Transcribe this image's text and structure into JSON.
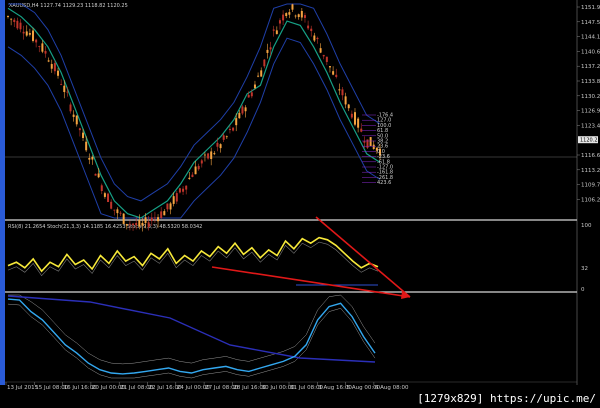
{
  "chart_data": {
    "type": "line",
    "header": {
      "symbol": "XAUUSD,H4",
      "ohlc": "1127.74 1129.23 1118.82 1120.25"
    },
    "price_axis": {
      "ticks": [
        "1151.94",
        "1147.54",
        "1144.14",
        "1140.64",
        "1137.24",
        "1133.84",
        "1130.24",
        "1126.94",
        "1123.44",
        "1120.25",
        "1116.64",
        "1113.24",
        "1109.74",
        "1106.24"
      ],
      "current_price": "1120.25"
    },
    "indicator_header": "RSI(8) 21.2654  Stoch(21,3,3) 14.1185 16.4253  Stoch(9,3,3) 48.5320 58.0342",
    "indicator_axis": [
      "100",
      "32",
      "0"
    ],
    "fib_labels": [
      "-176.4",
      "127.0",
      "100.0",
      "61.8",
      "50.0",
      "38.2",
      "23.6",
      "0.0",
      "-23.6",
      "-61.8",
      "-127.0",
      "-161.8",
      "-261.8",
      "423.6"
    ],
    "time_axis": [
      "13 Jul 2015",
      "15 Jul 08:00",
      "16 Jul 16:00",
      "20 Jul 00:00",
      "21 Jul 08:00",
      "22 Jul 16:00",
      "24 Jul 00:00",
      "27 Jul 08:00",
      "28 Jul 16:00",
      "30 Jul 00:00",
      "31 Jul 08:00",
      "3 Aug 16:00",
      "5 Aug 00:00",
      "6 Aug 08:00"
    ],
    "price_series": {
      "name": "",
      "ylim": [
        1104,
        1154
      ],
      "values": [
        1151,
        1149,
        1146,
        1142,
        1136,
        1128,
        1120,
        1112,
        1106,
        1103,
        1102,
        1104,
        1106,
        1110,
        1115,
        1118,
        1121,
        1125,
        1131,
        1138,
        1147,
        1153,
        1152,
        1147,
        1141,
        1134,
        1128,
        1122,
        1120
      ]
    },
    "rsi_series": {
      "name": "RSI(8)",
      "ylim": [
        0,
        100
      ],
      "values": [
        40,
        46,
        36,
        52,
        30,
        46,
        38,
        60,
        42,
        50,
        34,
        58,
        44,
        66,
        48,
        56,
        40,
        62,
        52,
        70,
        44,
        58,
        48,
        66,
        56,
        74,
        62,
        80,
        60,
        72,
        54,
        68,
        58,
        84,
        70,
        88,
        80,
        90,
        86,
        76,
        62,
        48,
        36,
        44,
        38
      ]
    },
    "trendlines": [
      {
        "name": "support-line",
        "from": [
          0.36,
          0.45
        ],
        "to": [
          0.68,
          0.85
        ]
      },
      {
        "name": "resistance-line",
        "from": [
          0.52,
          0.02
        ],
        "to": [
          0.68,
          0.85
        ]
      }
    ],
    "stoch_series": {
      "name": "Stoch(21,3,3)",
      "ylim": [
        0,
        100
      ],
      "values": [
        95,
        94,
        80,
        70,
        55,
        40,
        30,
        18,
        10,
        6,
        5,
        6,
        8,
        10,
        12,
        8,
        6,
        10,
        12,
        14,
        10,
        8,
        12,
        16,
        20,
        26,
        40,
        70,
        86,
        90,
        74,
        50,
        30
      ]
    },
    "grid": false,
    "colors": {
      "background": "#000000",
      "candle_up": "#f4a341",
      "candle_down": "#c0352b",
      "bollinger_outer": "#1f3fa8",
      "bollinger_mid": "#16a085",
      "rsi_line": "#f7e93a",
      "trendline": "#e01818",
      "stoch_line": "#33a8f0",
      "axis_line": "#e6e6e6"
    }
  },
  "watermark": "[1279x829] https://upic.me/"
}
